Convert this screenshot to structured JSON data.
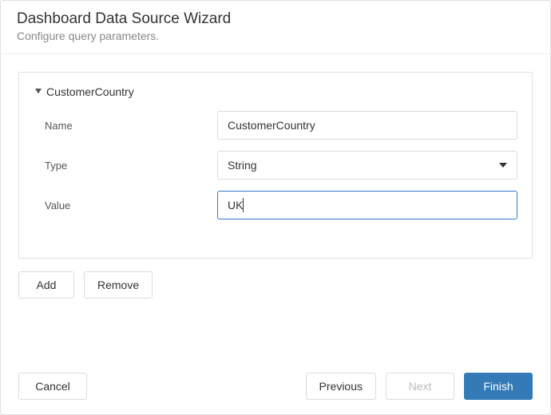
{
  "header": {
    "title": "Dashboard Data Source Wizard",
    "subtitle": "Configure query parameters."
  },
  "panel": {
    "title": "CustomerCountry",
    "fields": {
      "name_label": "Name",
      "name_value": "CustomerCountry",
      "type_label": "Type",
      "type_value": "String",
      "value_label": "Value",
      "value_value": "UK"
    }
  },
  "buttons": {
    "add": "Add",
    "remove": "Remove",
    "cancel": "Cancel",
    "previous": "Previous",
    "next": "Next",
    "finish": "Finish"
  }
}
